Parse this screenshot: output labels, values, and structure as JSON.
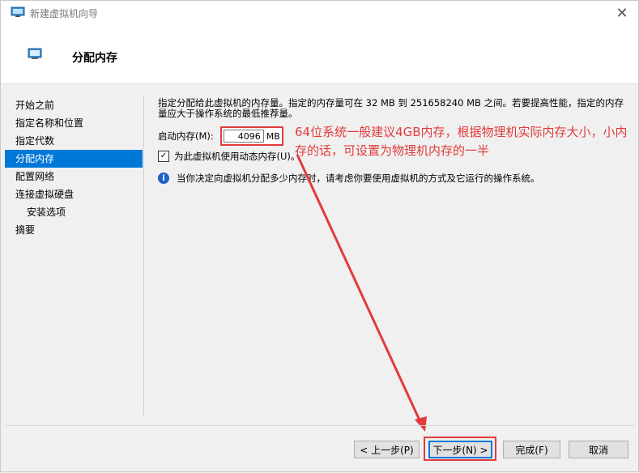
{
  "window": {
    "title": "新建虚拟机向导",
    "close_glyph": "✕"
  },
  "header": {
    "title": "分配内存"
  },
  "nav": {
    "items": [
      {
        "label": "开始之前",
        "active": false,
        "sub": false
      },
      {
        "label": "指定名称和位置",
        "active": false,
        "sub": false
      },
      {
        "label": "指定代数",
        "active": false,
        "sub": false
      },
      {
        "label": "分配内存",
        "active": true,
        "sub": false
      },
      {
        "label": "配置网络",
        "active": false,
        "sub": false
      },
      {
        "label": "连接虚拟硬盘",
        "active": false,
        "sub": false
      },
      {
        "label": "安装选项",
        "active": false,
        "sub": true
      },
      {
        "label": "摘要",
        "active": false,
        "sub": false
      }
    ]
  },
  "content": {
    "description": "指定分配给此虚拟机的内存量。指定的内存量可在 32 MB 到 251658240 MB 之间。若要提高性能，指定的内存量应大于操作系统的最低推荐量。",
    "startup_memory_label": "启动内存(M):",
    "startup_memory_value": "4096",
    "memory_unit": "MB",
    "dynamic_memory_label": "为此虚拟机使用动态内存(U)。",
    "dynamic_memory_checked": true,
    "checkmark": "✓",
    "info_glyph": "i",
    "info_text": "当你决定向虚拟机分配多少内存时，请考虑你要使用虚拟机的方式及它运行的操作系统。"
  },
  "annotation": {
    "text": "64位系统一般建议4GB内存，根据物理机实际内存大小，小内存的话，可设置为物理机内存的一半",
    "color": "#e23b3b"
  },
  "buttons": {
    "prev": "< 上一步(P)",
    "next": "下一步(N) >",
    "finish": "完成(F)",
    "cancel": "取消"
  },
  "colors": {
    "accent": "#0078d7",
    "highlight_red": "#e23b3b"
  }
}
